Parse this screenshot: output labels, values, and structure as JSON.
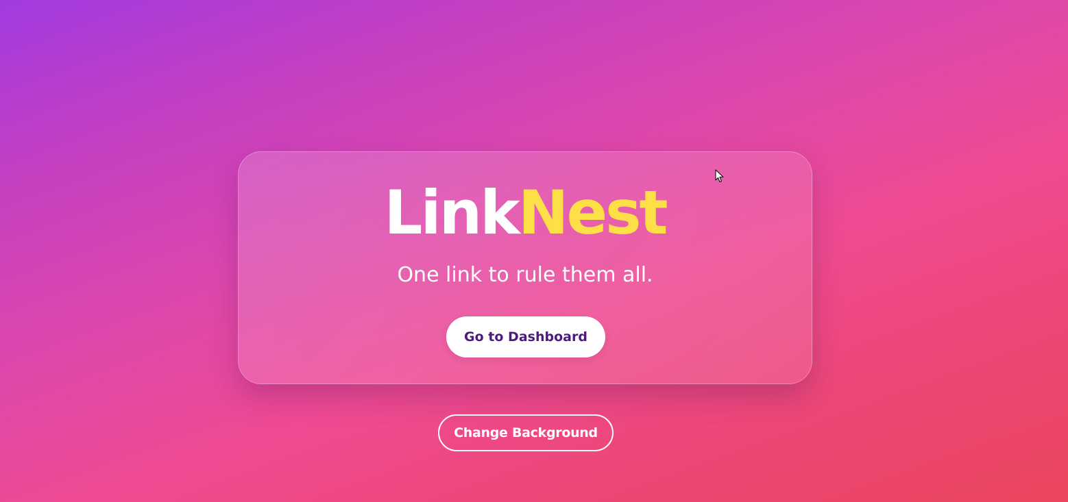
{
  "brand": {
    "part_1": "Link",
    "part_2": "Nest"
  },
  "tagline": "One link to rule them all.",
  "primary_button_label": "Go to Dashboard",
  "secondary_button_label": "Change Background",
  "colors": {
    "accent_yellow": "#fde047",
    "button_text_purple": "#4b1a7d",
    "gradient_start": "#a23be0",
    "gradient_middle": "#ef4a92",
    "gradient_end": "#ea465f"
  },
  "icons": {
    "cursor": "mouse-pointer-icon"
  }
}
